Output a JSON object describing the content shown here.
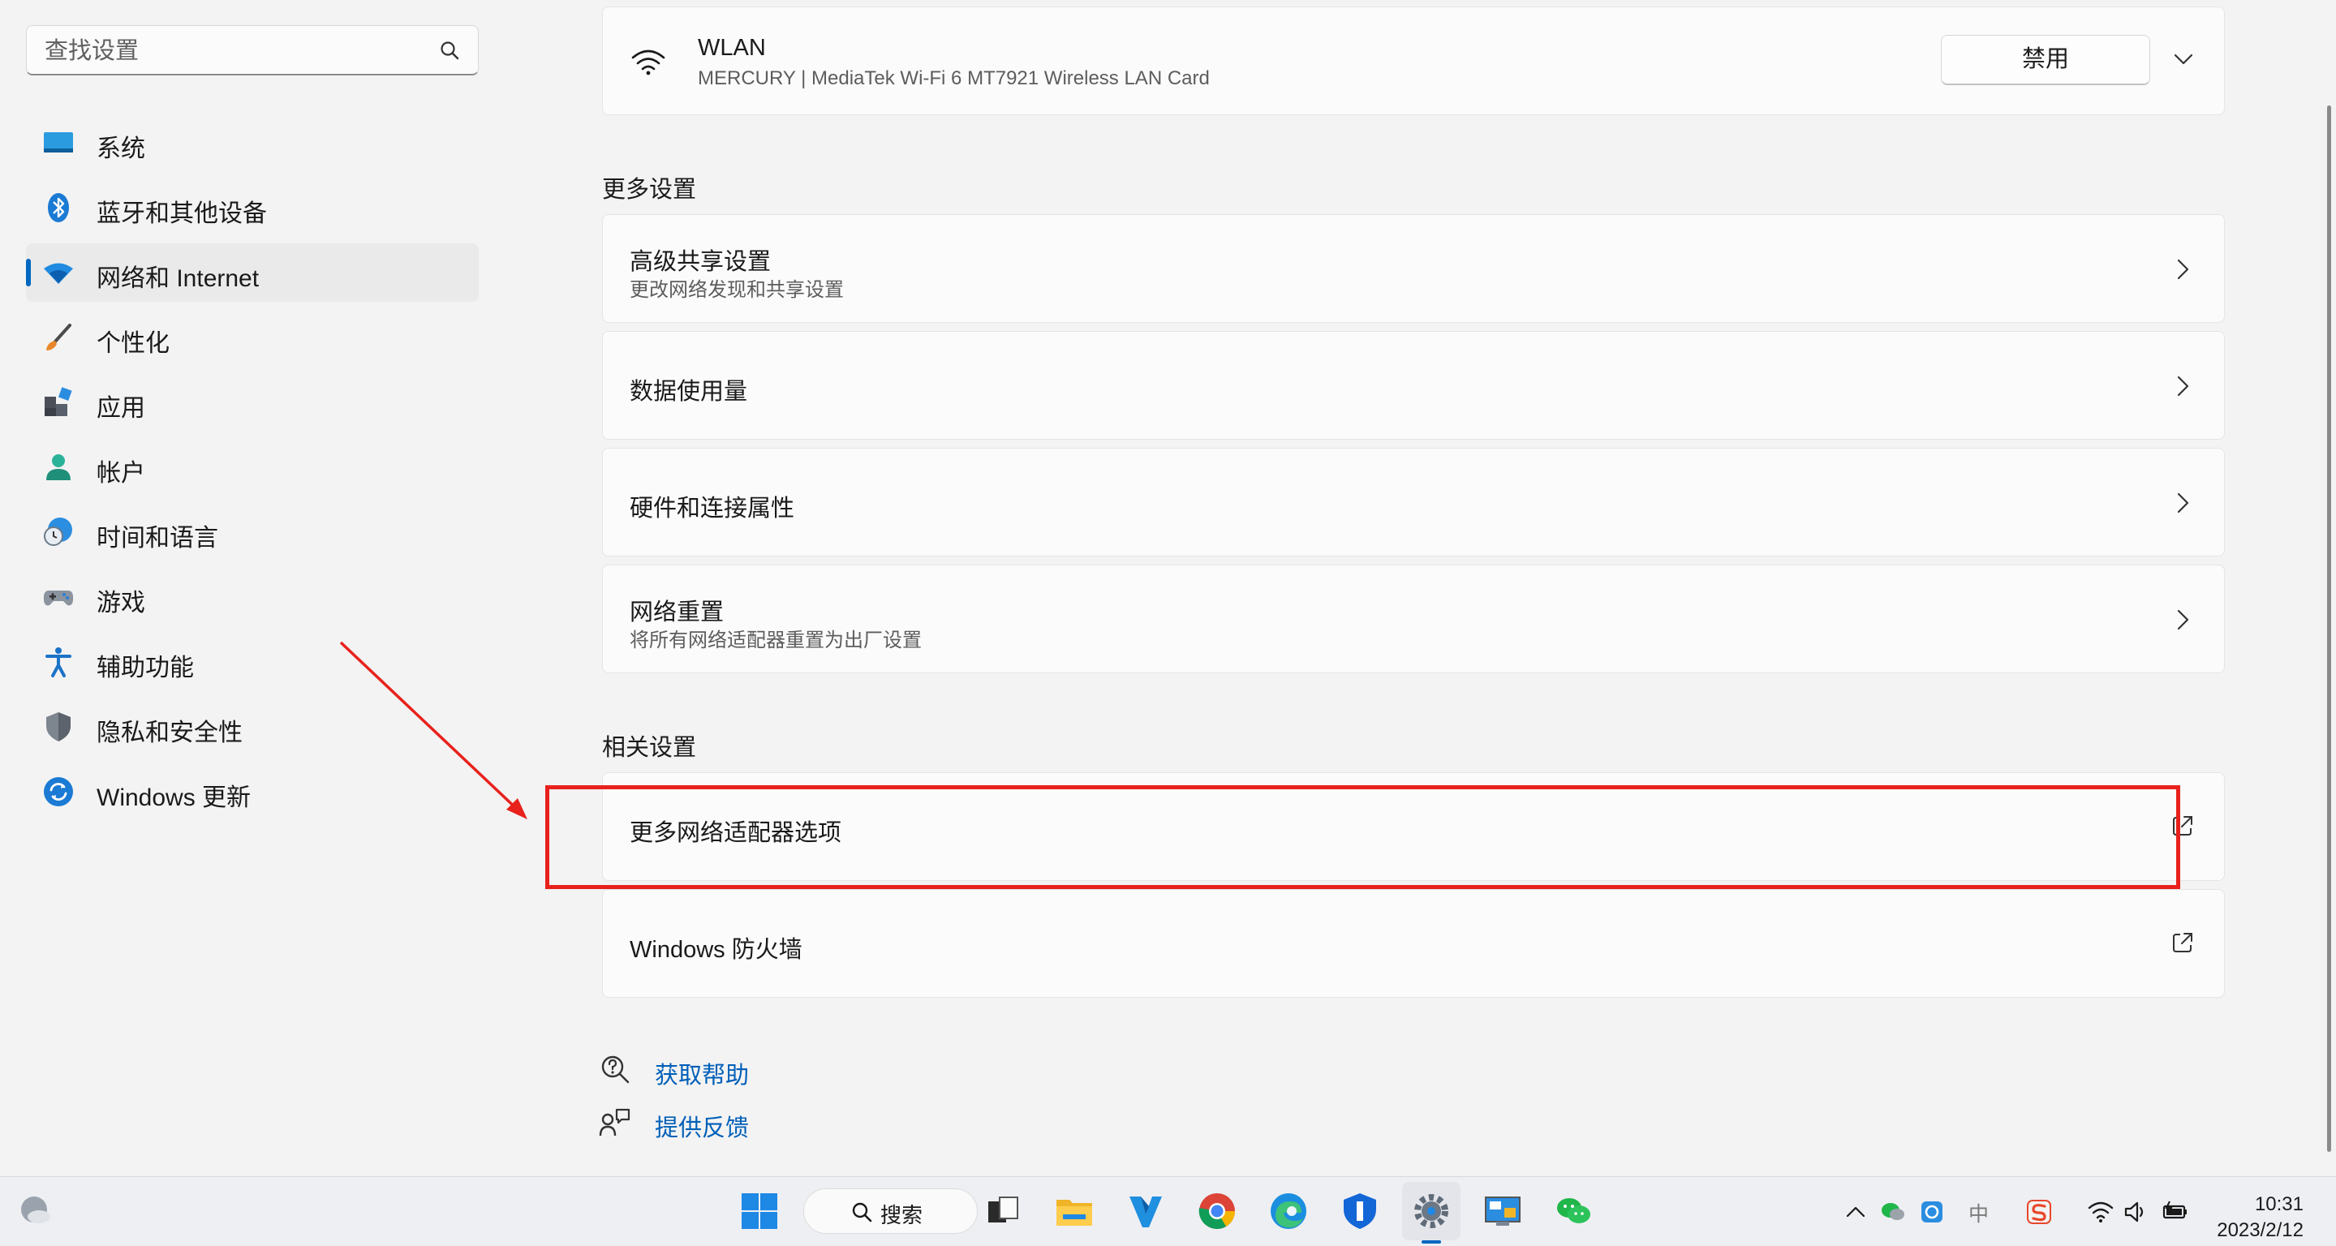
{
  "search": {
    "placeholder": "查找设置"
  },
  "sidebar": {
    "items": [
      {
        "label": "系统",
        "icon": "system-icon"
      },
      {
        "label": "蓝牙和其他设备",
        "icon": "bluetooth-icon"
      },
      {
        "label": "网络和 Internet",
        "icon": "wifi-icon",
        "active": true
      },
      {
        "label": "个性化",
        "icon": "brush-icon"
      },
      {
        "label": "应用",
        "icon": "apps-icon"
      },
      {
        "label": "帐户",
        "icon": "account-icon"
      },
      {
        "label": "时间和语言",
        "icon": "globe-clock-icon"
      },
      {
        "label": "游戏",
        "icon": "gamepad-icon"
      },
      {
        "label": "辅助功能",
        "icon": "accessibility-icon"
      },
      {
        "label": "隐私和安全性",
        "icon": "shield-icon"
      },
      {
        "label": "Windows 更新",
        "icon": "update-icon"
      }
    ]
  },
  "wlan": {
    "title": "WLAN",
    "subtitle": "MERCURY | MediaTek Wi-Fi 6 MT7921 Wireless LAN Card",
    "button": "禁用"
  },
  "more_settings": {
    "heading": "更多设置",
    "items": [
      {
        "title": "高级共享设置",
        "subtitle": "更改网络发现和共享设置"
      },
      {
        "title": "数据使用量"
      },
      {
        "title": "硬件和连接属性"
      },
      {
        "title": "网络重置",
        "subtitle": "将所有网络适配器重置为出厂设置"
      }
    ]
  },
  "related_settings": {
    "heading": "相关设置",
    "items": [
      {
        "title": "更多网络适配器选项",
        "highlighted": true
      },
      {
        "title": "Windows 防火墙"
      }
    ]
  },
  "help": {
    "get_help": "获取帮助",
    "feedback": "提供反馈"
  },
  "annotation": {
    "color": "#e8211c"
  },
  "taskbar": {
    "search_label": "搜索",
    "time": "10:31",
    "date": "2023/2/12",
    "ime": "中"
  },
  "colors": {
    "accent": "#0067c0",
    "link": "#005fb8",
    "highlight_box": "#e8211c"
  }
}
